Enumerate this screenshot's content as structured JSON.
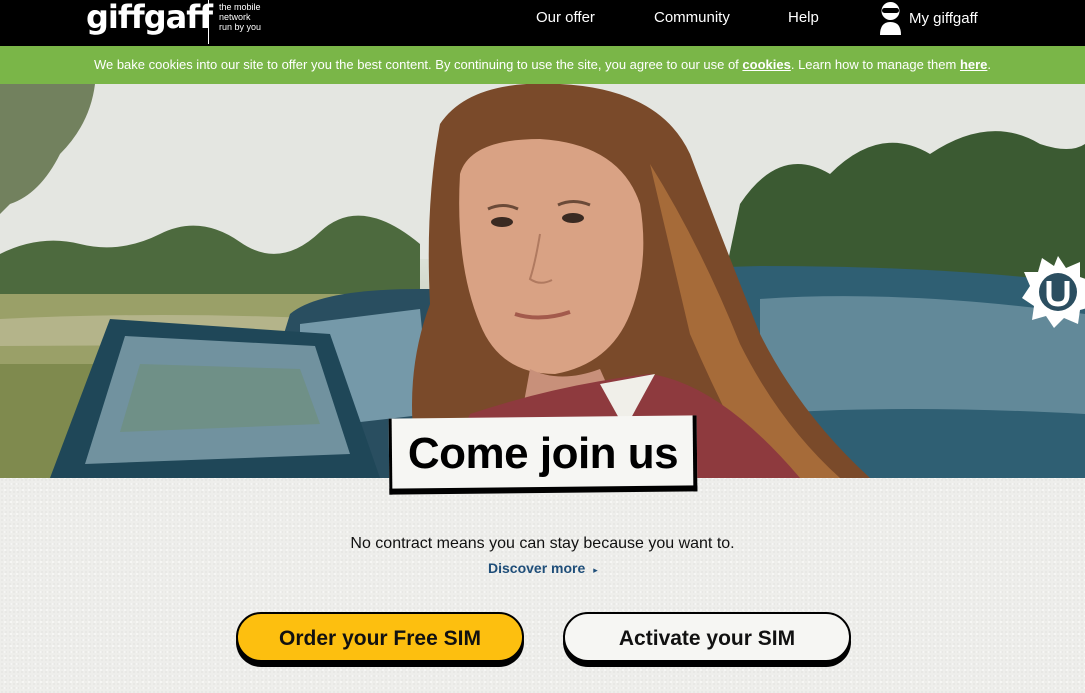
{
  "header": {
    "logo": "giffgaff",
    "tagline": [
      "the mobile",
      "network",
      "run by you"
    ],
    "nav": [
      {
        "label": "Our offer"
      },
      {
        "label": "Community"
      },
      {
        "label": "Help"
      }
    ],
    "account_label": "My giffgaff"
  },
  "cookie_banner": {
    "text_before": "We bake cookies into our site to offer you the best content. By continuing to use the site, you agree to our use of ",
    "cookies_link": "cookies",
    "text_middle": ". Learn how to manage them ",
    "here_link": "here",
    "text_after": "."
  },
  "hero": {
    "headline": "Come join us",
    "badge_icon": "sunburst-u-icon"
  },
  "main": {
    "subtext": "No contract means you can stay because you want to.",
    "discover_label": "Discover more",
    "discover_arrow": "▸",
    "order_button": "Order your Free SIM",
    "activate_button": "Activate your SIM"
  },
  "colors": {
    "nav_bg": "#000000",
    "cookie_bg": "#7ab648",
    "order_btn": "#fdbf0f",
    "link": "#1f4e79"
  }
}
